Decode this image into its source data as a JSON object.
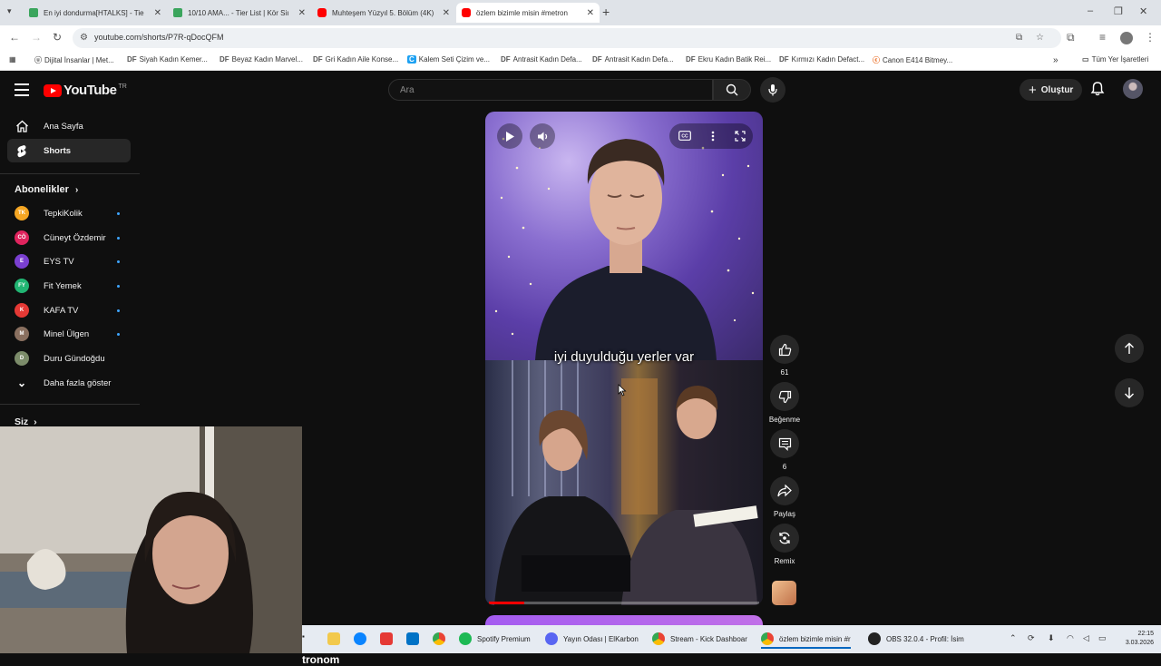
{
  "browser": {
    "tabs": [
      {
        "title": "En iyi dondurma[HTALKS] - Tie",
        "favicon_color": "#3ba55d"
      },
      {
        "title": "10/10 AMA... - Tier List | Kör Siı",
        "favicon_color": "#3ba55d"
      },
      {
        "title": "Muhteşem Yüzyıl 5. Bölüm (4K)",
        "favicon_color": "#ff0000"
      },
      {
        "title": "özlem bizimle misin #metron",
        "favicon_color": "#ff0000"
      }
    ],
    "url": "youtube.com/shorts/P7R-qDocQFM",
    "bookmarks": [
      "Dijital İnsanlar | Met...",
      "Siyah Kadın Kemer...",
      "Beyaz Kadın Marvel...",
      "Gri Kadın Aile Konse...",
      "Kalem Seti Çizim ve...",
      "Antrasit Kadın Defa...",
      "Antrasit Kadın Defa...",
      "Ekru Kadın Batik Rei...",
      "Kırmızı Kadın Defact...",
      "Canon E414 Bitmey..."
    ],
    "bookmark_prefixes": [
      "",
      "DF",
      "DF",
      "DF",
      "C",
      "DF",
      "DF",
      "DF",
      "DF",
      ""
    ],
    "all_bookmarks": "Tüm Yer İşaretleri"
  },
  "youtube": {
    "logo_text": "YouTube",
    "region": "TR",
    "search_placeholder": "Ara",
    "create_label": "Oluştur",
    "sidebar": {
      "home": "Ana Sayfa",
      "shorts": "Shorts",
      "subscriptions_heading": "Abonelikler",
      "channels": [
        {
          "name": "TepkiKolik",
          "color": "#f5a623",
          "initials": "TK"
        },
        {
          "name": "Cüneyt Özdemir",
          "color": "#e0245e",
          "initials": "CÖ"
        },
        {
          "name": "EYS TV",
          "color": "#7a3fd0",
          "initials": "E"
        },
        {
          "name": "Fit Yemek",
          "color": "#21b573",
          "initials": "FY"
        },
        {
          "name": "KAFA TV",
          "color": "#e53935",
          "initials": "K"
        },
        {
          "name": "Minel Ülgen",
          "color": "#8a7060",
          "initials": "M"
        },
        {
          "name": "Duru Gündoğdu",
          "color": "#7c8c6a",
          "initials": "D"
        }
      ],
      "show_more": "Daha fazla göster",
      "you_heading": "Siz"
    },
    "short": {
      "subtitle": "iyi duyulduğu yerler var",
      "progress": 0.13,
      "partial_title": "tronom"
    },
    "actions": {
      "like_count": "61",
      "dislike_label": "Beğenme",
      "comment_count": "6",
      "share_label": "Paylaş",
      "remix_label": "Remix"
    }
  },
  "taskbar": {
    "items": [
      {
        "label": "",
        "color": "#f2c94c"
      },
      {
        "label": "",
        "color": "#0a84ff"
      },
      {
        "label": "",
        "color": "#e53935"
      },
      {
        "label": "",
        "color": "#0072c6"
      },
      {
        "label": "",
        "color": "#fbbc05"
      },
      {
        "label": "Spotify Premium",
        "color": "#1db954"
      },
      {
        "label": "Yayın Odası | ElKarbon",
        "color": "#5865f2"
      },
      {
        "label": "Stream - Kick Dashboar",
        "color": "#34a853"
      },
      {
        "label": "özlem bizimle misin #r",
        "color": "#34a853"
      },
      {
        "label": "OBS 32.0.4 - Profil: İsim",
        "color": "#222222"
      }
    ],
    "time": "22:15",
    "date": "3.03.2026"
  }
}
